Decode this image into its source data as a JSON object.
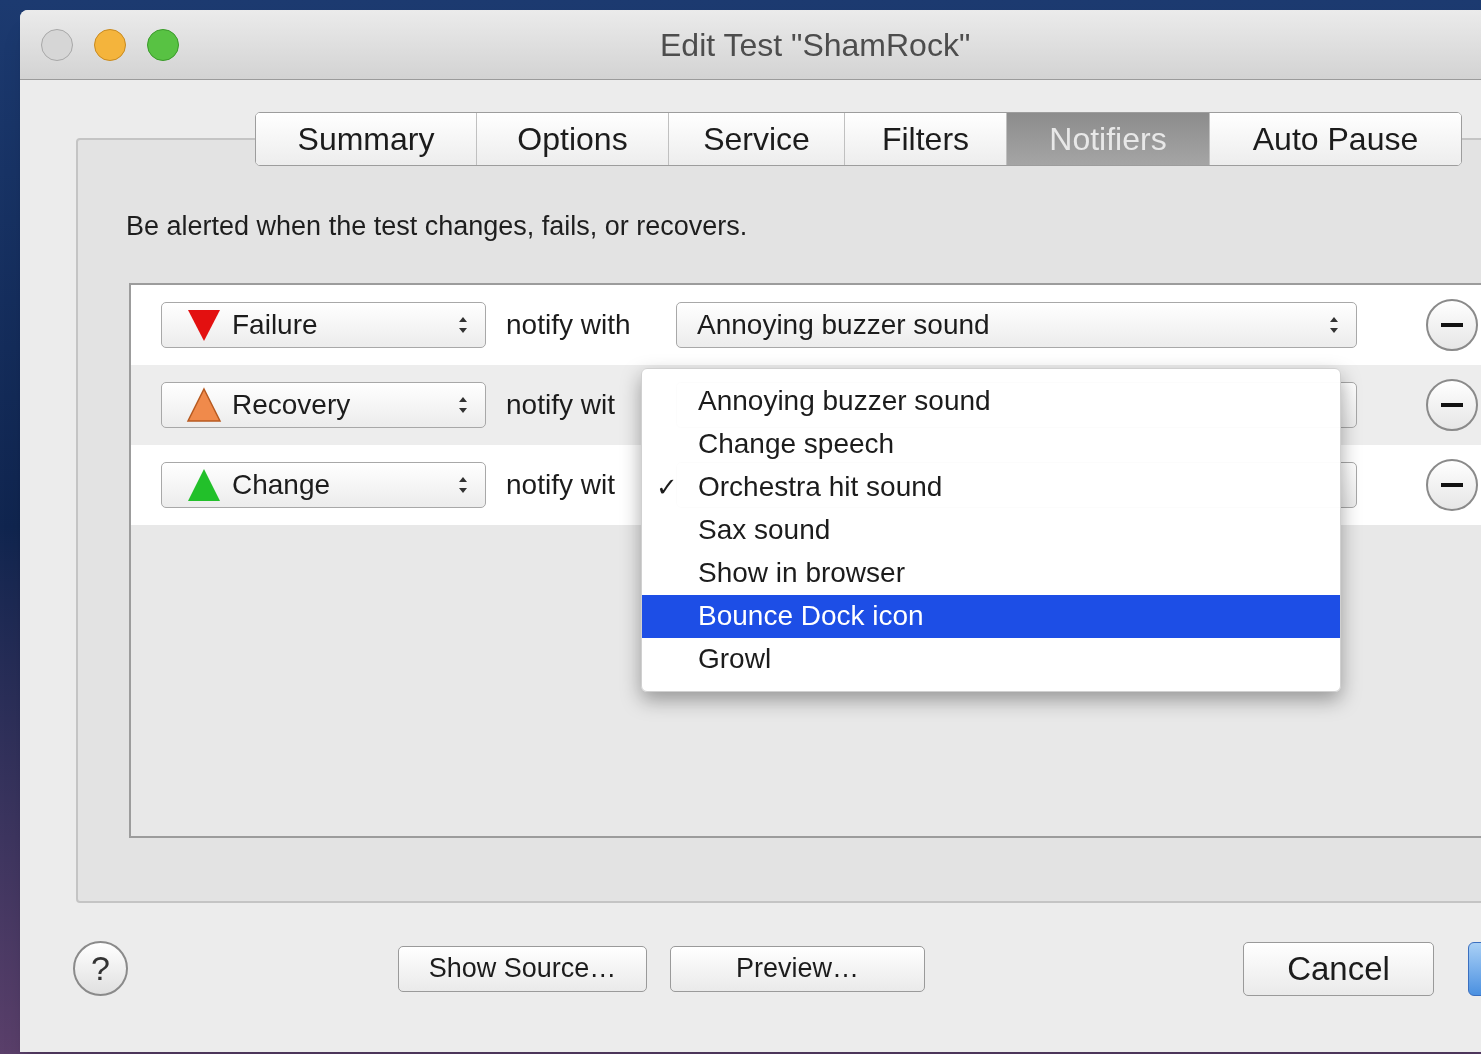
{
  "window": {
    "title": "Edit Test \"ShamRock\""
  },
  "tabs": [
    {
      "label": "Summary",
      "selected": false
    },
    {
      "label": "Options",
      "selected": false
    },
    {
      "label": "Service",
      "selected": false
    },
    {
      "label": "Filters",
      "selected": false
    },
    {
      "label": "Notifiers",
      "selected": true
    },
    {
      "label": "Auto Pause",
      "selected": false
    }
  ],
  "description": "Be alerted when the test changes, fails, or recovers.",
  "notifiers": [
    {
      "kind": "failure",
      "event": "Failure",
      "connector": "notify with",
      "action": "Annoying buzzer sound"
    },
    {
      "kind": "recovery",
      "event": "Recovery",
      "connector": "notify wit"
    },
    {
      "kind": "change",
      "event": "Change",
      "connector": "notify wit"
    }
  ],
  "menu": {
    "items": [
      {
        "label": "Annoying buzzer sound",
        "checked": false,
        "selected": false
      },
      {
        "label": "Change speech",
        "checked": false,
        "selected": false
      },
      {
        "label": "Orchestra hit sound",
        "checked": true,
        "selected": false
      },
      {
        "label": "Sax sound",
        "checked": false,
        "selected": false
      },
      {
        "label": "Show in browser",
        "checked": false,
        "selected": false
      },
      {
        "label": "Bounce Dock icon",
        "checked": false,
        "selected": true
      },
      {
        "label": "Growl",
        "checked": false,
        "selected": false
      }
    ],
    "check_mark": "✓"
  },
  "help_button": "?",
  "buttons": [
    {
      "label": "Show Source…",
      "kind": "normal"
    },
    {
      "label": "Preview…",
      "kind": "normal"
    },
    {
      "label": "Cancel",
      "kind": "normal"
    },
    {
      "kind": "default"
    }
  ]
}
